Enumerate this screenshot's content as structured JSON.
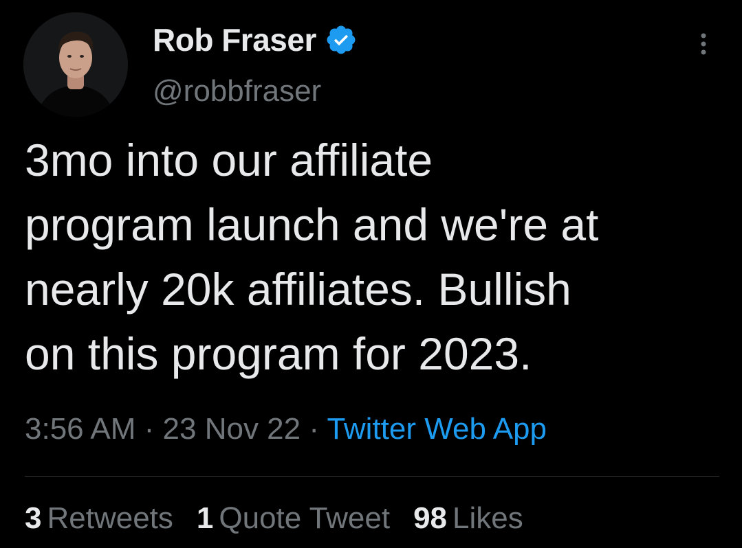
{
  "user": {
    "display_name": "Rob Fraser",
    "handle": "@robbfraser",
    "verified_icon": "verified-badge-icon",
    "avatar_icon": "avatar-photo"
  },
  "tweet": {
    "text": "3mo into our affiliate\nprogram launch and we're at\nnearly 20k affiliates. Bullish\non this program for 2023.",
    "time": "3:56 AM",
    "sep1": " · ",
    "date": "23 Nov 22",
    "sep2": " · ",
    "source": "Twitter Web App"
  },
  "stats": {
    "retweets_count": "3",
    "retweets_label": "Retweets",
    "quotes_count": "1",
    "quotes_label": "Quote Tweet",
    "likes_count": "98",
    "likes_label": "Likes"
  },
  "more_icon": "more-vertical-icon",
  "colors": {
    "background": "#000000",
    "primary_text": "#e7e9ea",
    "secondary_text": "#71767b",
    "accent": "#1d9bf0",
    "divider": "#2f3336"
  }
}
